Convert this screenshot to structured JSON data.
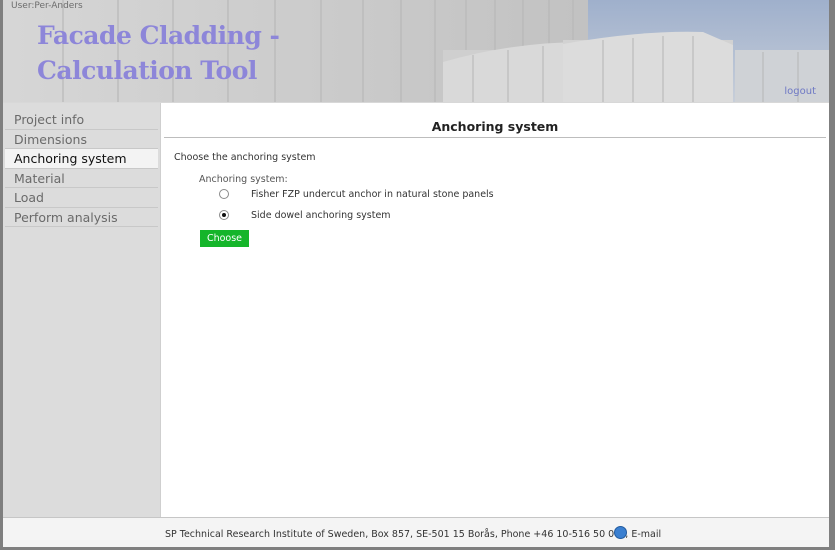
{
  "header": {
    "user": "User:Per-Anders",
    "title_line1": "Facade Cladding -",
    "title_line2": "Calculation Tool",
    "logout_label": "logout"
  },
  "sidebar": {
    "items": [
      {
        "label": "Project info"
      },
      {
        "label": "Dimensions"
      },
      {
        "label": "Anchoring system"
      },
      {
        "label": "Material"
      },
      {
        "label": "Load"
      },
      {
        "label": "Perform analysis"
      }
    ],
    "active_index": 2
  },
  "main": {
    "title": "Anchoring system",
    "prompt": "Choose the anchoring system",
    "group_label": "Anchoring system:",
    "options": [
      {
        "label": "Fisher FZP undercut anchor in natural stone panels",
        "selected": false
      },
      {
        "label": "Side dowel anchoring system",
        "selected": true
      }
    ],
    "choose_label": "Choose"
  },
  "footer": {
    "text": "SP Technical Research Institute of Sweden, Box 857, SE-501 15 Borås, Phone +46 10-516 50 000",
    "email_label": ", E-mail"
  },
  "colors": {
    "title": "#8d86d9",
    "button": "#15b52a",
    "logout_link": "#6e78c4"
  }
}
